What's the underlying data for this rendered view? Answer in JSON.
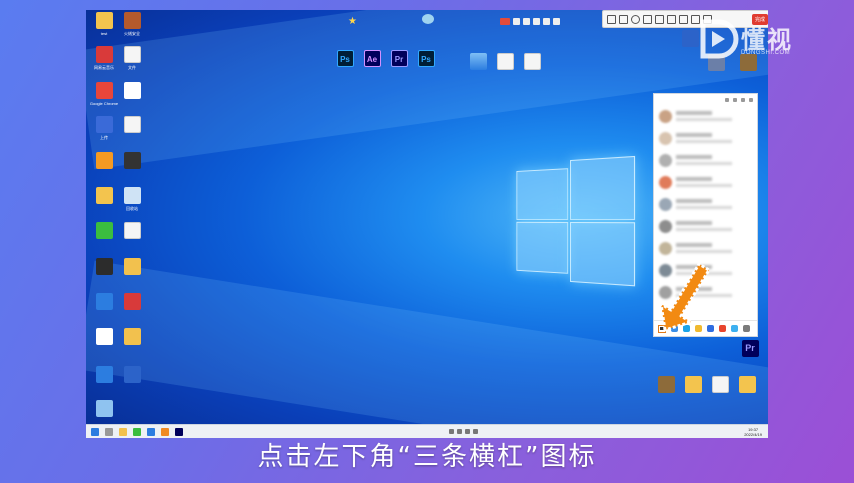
{
  "toolbar": {
    "finish_label": "完成"
  },
  "watermark": {
    "brand": "懂视",
    "site": "DONGSHI.COM"
  },
  "caption": "点击左下角“三条横杠”图标",
  "desktop_icons_left": [
    {
      "label": "test",
      "kind": "folder"
    },
    {
      "label": "火绒安全",
      "kind": "app",
      "color": "#b55a2c"
    },
    {
      "label": "网易云音乐",
      "kind": "app",
      "color": "#d93a3a"
    },
    {
      "label": "文件",
      "kind": "doc"
    },
    {
      "label": "Google Chrome",
      "kind": "app",
      "color": "#e8463b"
    },
    {
      "label": "",
      "kind": "app",
      "color": "#ffffff"
    },
    {
      "label": "上传",
      "kind": "app",
      "color": "#3a6ad8"
    },
    {
      "label": "",
      "kind": "doc"
    },
    {
      "label": "",
      "kind": "app",
      "color": "#f59a23"
    },
    {
      "label": "",
      "kind": "app",
      "color": "#333333"
    },
    {
      "label": "",
      "kind": "folder"
    },
    {
      "label": "回收站",
      "kind": "app",
      "color": "#cfe3f5"
    },
    {
      "label": "",
      "kind": "app",
      "color": "#3bbd3f"
    },
    {
      "label": "",
      "kind": "doc"
    }
  ],
  "adobe_icons": [
    {
      "label": "Ps",
      "color": "#31a8ff",
      "bg": "#001e36"
    },
    {
      "label": "Ae",
      "color": "#d291ff",
      "bg": "#00005b"
    },
    {
      "label": "Pr",
      "color": "#9999ff",
      "bg": "#00005b"
    },
    {
      "label": "Ps",
      "color": "#31a8ff",
      "bg": "#001e36"
    }
  ],
  "pr_icon": {
    "label": "Pr"
  },
  "taskbar": {
    "time": "19:37",
    "date": "2022/4/19"
  }
}
